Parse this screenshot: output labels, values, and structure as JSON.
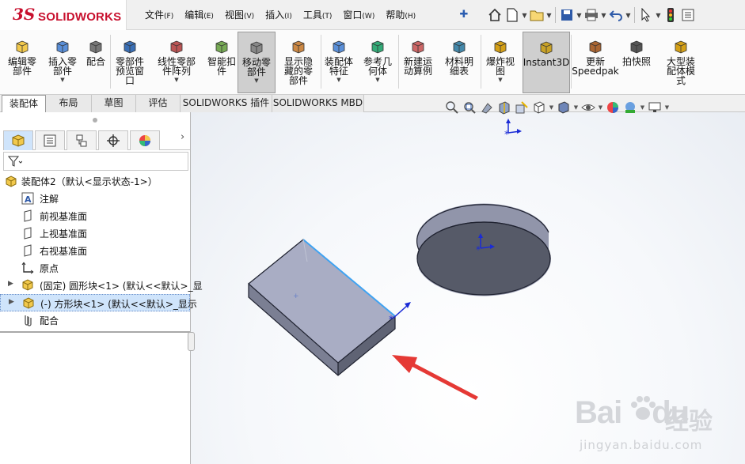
{
  "app": {
    "brand_ds": "3S",
    "brand_name": "SOLIDWORKS",
    "accent_color": "#c8102e"
  },
  "menubar": [
    {
      "label": "文件",
      "key": "(F)"
    },
    {
      "label": "编辑",
      "key": "(E)"
    },
    {
      "label": "视图",
      "key": "(V)"
    },
    {
      "label": "插入",
      "key": "(I)"
    },
    {
      "label": "工具",
      "key": "(T)"
    },
    {
      "label": "窗口",
      "key": "(W)"
    },
    {
      "label": "帮助",
      "key": "(H)"
    }
  ],
  "quick_access": [
    "home-icon",
    "new-document-icon",
    "open-folder-icon",
    "save-icon",
    "print-icon",
    "undo-icon",
    "select-cursor-icon",
    "traffic-light-icon",
    "options-icon"
  ],
  "ribbon": [
    {
      "label": "编辑零\n部件",
      "icon": "edit-component-icon",
      "dropdown": false
    },
    {
      "label": "插入零\n部件",
      "icon": "insert-component-icon",
      "dropdown": true
    },
    {
      "label": "配合",
      "icon": "mate-icon",
      "dropdown": false
    },
    {
      "label": "零部件\n预览窗\n口",
      "icon": "component-preview-icon",
      "dropdown": false
    },
    {
      "label": "线性零部\n件阵列",
      "icon": "linear-pattern-icon",
      "dropdown": true
    },
    {
      "label": "智能扣\n件",
      "icon": "smart-fastener-icon",
      "dropdown": false
    },
    {
      "label": "移动零\n部件",
      "icon": "move-component-icon",
      "dropdown": true,
      "active": true
    },
    {
      "label": "显示隐\n藏的零\n部件",
      "icon": "show-hidden-icon",
      "dropdown": false
    },
    {
      "label": "装配体\n特征",
      "icon": "assembly-feature-icon",
      "dropdown": true
    },
    {
      "label": "参考几\n何体",
      "icon": "reference-geometry-icon",
      "dropdown": true
    },
    {
      "label": "新建运\n动算例",
      "icon": "motion-study-icon",
      "dropdown": false
    },
    {
      "label": "材料明\n细表",
      "icon": "bom-icon",
      "dropdown": false
    },
    {
      "label": "爆炸视\n图",
      "icon": "exploded-view-icon",
      "dropdown": true
    },
    {
      "label": "Instant3D",
      "icon": "instant3d-icon",
      "dropdown": false,
      "active": true
    },
    {
      "label": "更新\nSpeedpak",
      "icon": "speedpak-icon",
      "dropdown": false
    },
    {
      "label": "拍快照",
      "icon": "snapshot-icon",
      "dropdown": false
    },
    {
      "label": "大型装\n配体模\n式",
      "icon": "large-assembly-icon",
      "dropdown": false
    }
  ],
  "command_tabs": [
    {
      "label": "装配体",
      "active": true
    },
    {
      "label": "布局",
      "active": false
    },
    {
      "label": "草图",
      "active": false
    },
    {
      "label": "评估",
      "active": false
    },
    {
      "label": "SOLIDWORKS 插件",
      "active": false
    },
    {
      "label": "SOLIDWORKS MBD",
      "active": false
    }
  ],
  "view_toolbar": [
    "zoom-to-fit-icon",
    "zoom-area-icon",
    "previous-view-icon",
    "section-view-icon",
    "dynamic-annotation-icon",
    "view-orientation-icon",
    "display-style-icon",
    "hide-show-icon",
    "appearance-icon",
    "scene-icon",
    "display-settings-icon"
  ],
  "panel_tabs": [
    "featuremanager-icon",
    "propertymanager-icon",
    "configurationmanager-icon",
    "dimxpert-icon",
    "display-manager-icon"
  ],
  "tree": {
    "root": "装配体2（默认<显示状态-1>）",
    "items": [
      {
        "label": "注解",
        "icon": "annotation-icon",
        "expandable": false,
        "selected": false
      },
      {
        "label": "前视基准面",
        "icon": "plane-icon",
        "expandable": false,
        "selected": false
      },
      {
        "label": "上视基准面",
        "icon": "plane-icon",
        "expandable": false,
        "selected": false
      },
      {
        "label": "右视基准面",
        "icon": "plane-icon",
        "expandable": false,
        "selected": false
      },
      {
        "label": "原点",
        "icon": "origin-icon",
        "expandable": false,
        "selected": false
      },
      {
        "label": "(固定) 圆形块<1> (默认<<默认>_显",
        "icon": "part-icon",
        "expandable": true,
        "selected": false
      },
      {
        "label": "(-) 方形块<1> (默认<<默认>_显示",
        "icon": "part-icon",
        "expandable": true,
        "selected": true
      },
      {
        "label": "配合",
        "icon": "mates-folder-icon",
        "expandable": false,
        "selected": false
      }
    ]
  },
  "scene": {
    "objects": [
      "rectangular-block",
      "cylinder-disc"
    ],
    "face_color": "#a9adc4",
    "dark_face_color": "#565a68",
    "edge_highlight_color": "#3fa3f2",
    "arrow_color": "#e53935"
  },
  "watermark": {
    "brand_prefix": "Bai",
    "brand_suffix": "du",
    "brand_cn": "经验",
    "url": "jingyan.baidu.com"
  }
}
